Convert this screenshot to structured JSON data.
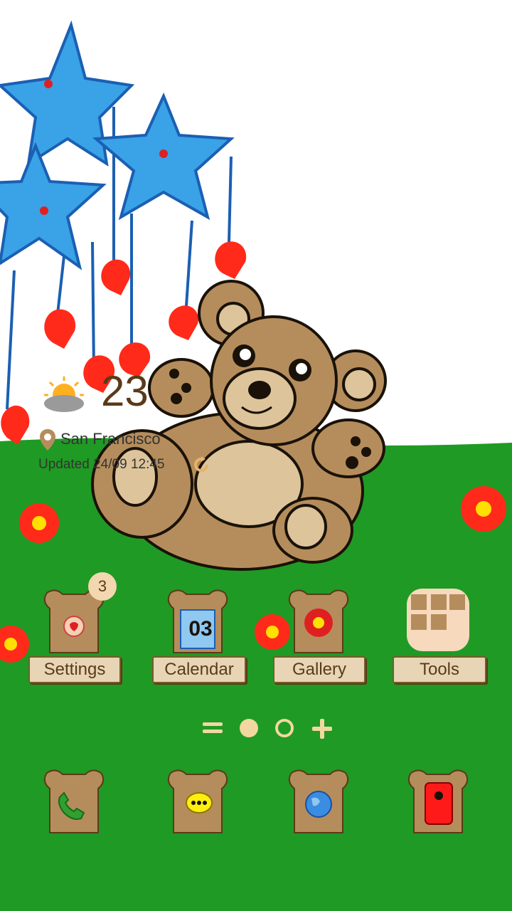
{
  "weather": {
    "temperature": "23",
    "location": "San Francisco",
    "updated": "Updated 24/09 12:45"
  },
  "apps": [
    {
      "label": "Settings",
      "badge": "3"
    },
    {
      "label": "Calendar",
      "calendar_day": "03"
    },
    {
      "label": "Gallery"
    },
    {
      "label": "Tools"
    }
  ],
  "dock": [
    {
      "name": "phone"
    },
    {
      "name": "messages"
    },
    {
      "name": "internet"
    },
    {
      "name": "camera"
    }
  ],
  "colors": {
    "grass": "#1f9a24",
    "sky": "#ffffff",
    "bear": "#b58d5c",
    "star": "#3aa2e6",
    "heart": "#ff2a1a",
    "label_bg": "#e8d5b5",
    "text_brown": "#5a3b18"
  }
}
